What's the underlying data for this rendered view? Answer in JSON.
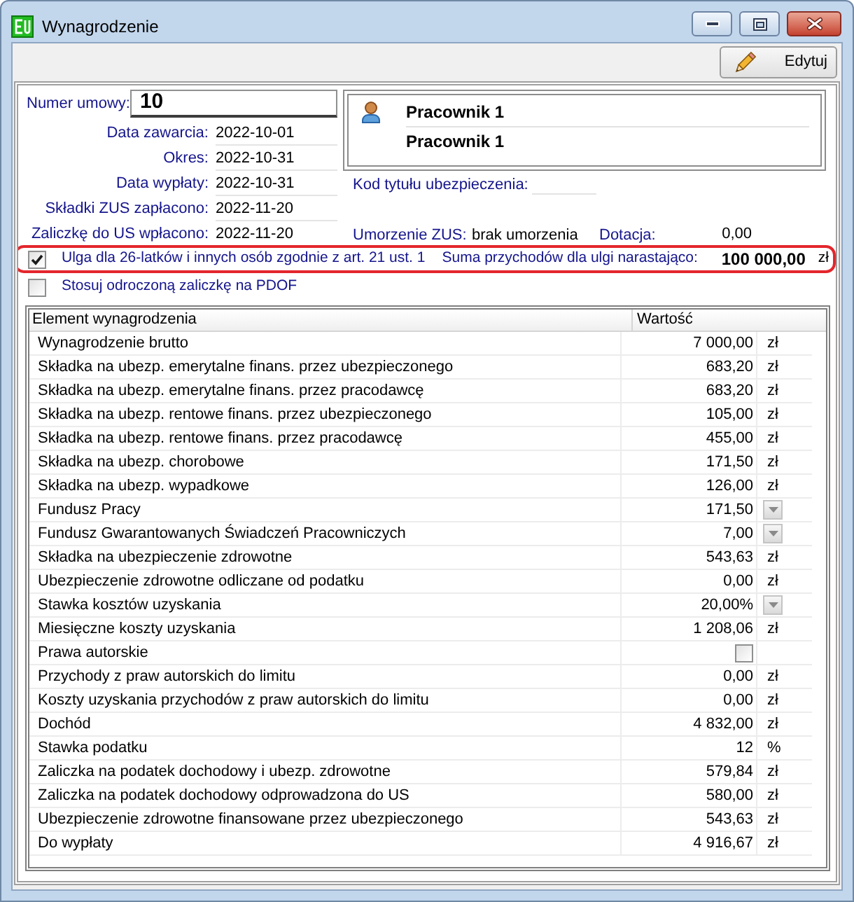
{
  "window": {
    "title": "Wynagrodzenie"
  },
  "toolbar": {
    "edit_button": "Edytuj"
  },
  "contract": {
    "number_label": "Numer umowy:",
    "number": "10",
    "dates": [
      {
        "label": "Data zawarcia:",
        "value": "2022-10-01"
      },
      {
        "label": "Okres:",
        "value": "2022-10-31"
      },
      {
        "label": "Data wypłaty:",
        "value": "2022-10-31"
      },
      {
        "label": "Składki ZUS zapłacono:",
        "value": "2022-11-20"
      },
      {
        "label": "Zaliczkę do US wpłacono:",
        "value": "2022-11-20"
      }
    ]
  },
  "employee": {
    "lines": [
      "Pracownik 1",
      "Pracownik 1"
    ]
  },
  "insurance_code": {
    "label": "Kod tytułu ubezpieczenia:"
  },
  "zus_relief": {
    "label": "Umorzenie ZUS:",
    "value": "brak umorzenia"
  },
  "subsidy": {
    "label": "Dotacja:",
    "value": "0,00"
  },
  "options": [
    {
      "label": "Ulga dla 26-latków i innych osób zgodnie z art. 21 ust. 1",
      "checked": true,
      "highlighted": true,
      "sum_label": "Suma przychodów dla ulgi narastająco:",
      "sum_value": "100 000,00",
      "sum_unit": "zł"
    },
    {
      "label": "Stosuj odroczoną zaliczkę na PDOF",
      "checked": false,
      "highlighted": false
    }
  ],
  "table": {
    "columns": [
      "Element wynagrodzenia",
      "Wartość"
    ],
    "rows": [
      {
        "kind": "amount",
        "name": "Wynagrodzenie brutto",
        "value": "7 000,00",
        "unit": "zł"
      },
      {
        "kind": "amount",
        "name": "Składka na ubezp. emerytalne finans. przez ubezpieczonego",
        "value": "683,20",
        "unit": "zł"
      },
      {
        "kind": "amount",
        "name": "Składka na ubezp. emerytalne finans. przez pracodawcę",
        "value": "683,20",
        "unit": "zł"
      },
      {
        "kind": "amount",
        "name": "Składka na ubezp. rentowe finans. przez ubezpieczonego",
        "value": "105,00",
        "unit": "zł"
      },
      {
        "kind": "amount",
        "name": "Składka na ubezp. rentowe finans. przez pracodawcę",
        "value": "455,00",
        "unit": "zł"
      },
      {
        "kind": "amount",
        "name": "Składka na ubezp. chorobowe",
        "value": "171,50",
        "unit": "zł"
      },
      {
        "kind": "amount",
        "name": "Składka na ubezp. wypadkowe",
        "value": "126,00",
        "unit": "zł"
      },
      {
        "kind": "dropdown",
        "name": "Fundusz Pracy",
        "value": "171,50"
      },
      {
        "kind": "dropdown",
        "name": "Fundusz Gwarantowanych Świadczeń Pracowniczych",
        "value": "7,00"
      },
      {
        "kind": "amount",
        "name": "Składka na ubezpieczenie zdrowotne",
        "value": "543,63",
        "unit": "zł"
      },
      {
        "kind": "amount",
        "name": "Ubezpieczenie zdrowotne odliczane od podatku",
        "value": "0,00",
        "unit": "zł"
      },
      {
        "kind": "dropdown",
        "name": "Stawka kosztów uzyskania",
        "value": "20,00%"
      },
      {
        "kind": "amount",
        "name": "Miesięczne koszty uzyskania",
        "value": "1 208,06",
        "unit": "zł"
      },
      {
        "kind": "checkbox",
        "name": "Prawa autorskie",
        "checked": false
      },
      {
        "kind": "amount",
        "name": "Przychody z praw autorskich do limitu",
        "value": "0,00",
        "unit": "zł"
      },
      {
        "kind": "amount",
        "name": "Koszty uzyskania przychodów z praw autorskich do limitu",
        "value": "0,00",
        "unit": "zł"
      },
      {
        "kind": "amount",
        "name": "Dochód",
        "value": "4 832,00",
        "unit": "zł"
      },
      {
        "kind": "amount",
        "name": "Stawka podatku",
        "value": "12",
        "unit": "%"
      },
      {
        "kind": "amount",
        "name": "Zaliczka na podatek dochodowy i ubezp. zdrowotne",
        "value": "579,84",
        "unit": "zł"
      },
      {
        "kind": "amount",
        "name": "Zaliczka na podatek dochodowy odprowadzona do US",
        "value": "580,00",
        "unit": "zł"
      },
      {
        "kind": "amount",
        "name": "Ubezpieczenie zdrowotne finansowane przez ubezpieczonego",
        "value": "543,63",
        "unit": "zł"
      },
      {
        "kind": "amount",
        "name": "Do wypłaty",
        "value": "4 916,67",
        "unit": "zł"
      }
    ]
  }
}
